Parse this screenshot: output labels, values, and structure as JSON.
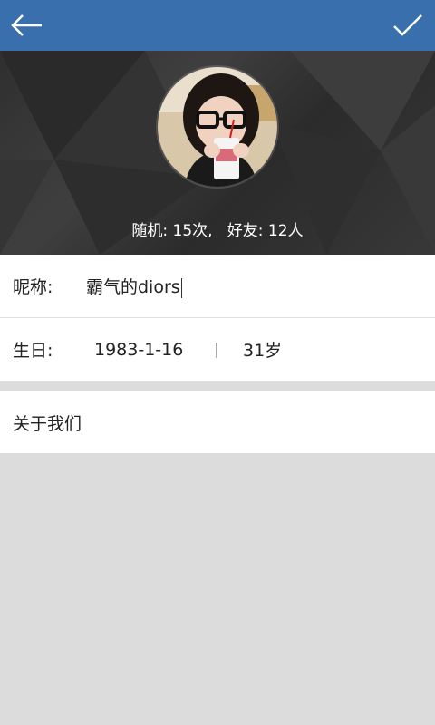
{
  "header": {
    "back_icon": "arrow-left-icon",
    "confirm_icon": "checkmark-icon",
    "bar_color": "#3a6fae"
  },
  "profile": {
    "stats_text": "随机: 15次,   好友: 12人"
  },
  "form": {
    "nickname_label": "昵称:",
    "nickname_value": "霸气的diors",
    "birthday_label": "生日:",
    "birthday_value": "1983-1-16",
    "separator": "|",
    "age_value": "31岁"
  },
  "menu": {
    "about_label": "关于我们"
  }
}
